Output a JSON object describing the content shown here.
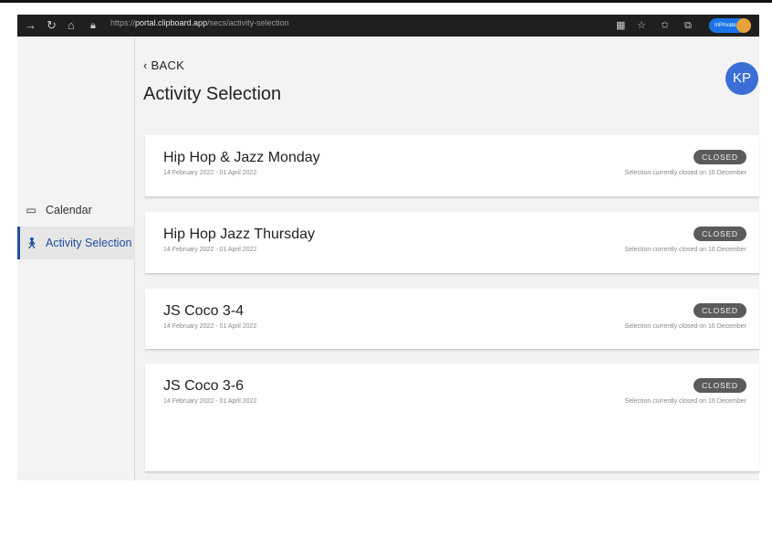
{
  "browser": {
    "url_prefix": "https://",
    "url_domain": "portal.clipboard.app",
    "url_path": "/secs/activity-selection",
    "inprivate_label": "InPrivate"
  },
  "sidebar": {
    "items": [
      {
        "label": "Calendar",
        "icon": "calendar-icon",
        "active": false
      },
      {
        "label": "Activity Selection",
        "icon": "walking-person-icon",
        "active": true
      }
    ]
  },
  "header": {
    "back_label": "BACK",
    "title": "Activity Selection",
    "avatar_initials": "KP"
  },
  "activities": [
    {
      "name": "Hip Hop & Jazz Monday",
      "dates": "14 February 2022 - 01 April 2022",
      "status": "CLOSED",
      "note": "Selection currently closed on 16 December"
    },
    {
      "name": "Hip Hop Jazz Thursday",
      "dates": "14 February 2022 - 01 April 2022",
      "status": "CLOSED",
      "note": "Selection currently closed on 16 December"
    },
    {
      "name": "JS Coco 3-4",
      "dates": "14 February 2022 - 01 April 2022",
      "status": "CLOSED",
      "note": "Selection currently closed on 16 December"
    },
    {
      "name": "JS Coco 3-6",
      "dates": "14 February 2022 - 01 April 2022",
      "status": "CLOSED",
      "note": "Selection currently closed on 16 December"
    }
  ],
  "colors": {
    "accent": "#1f4fa0",
    "badge": "#5b5b5b",
    "avatar": "#3b6fd6"
  }
}
